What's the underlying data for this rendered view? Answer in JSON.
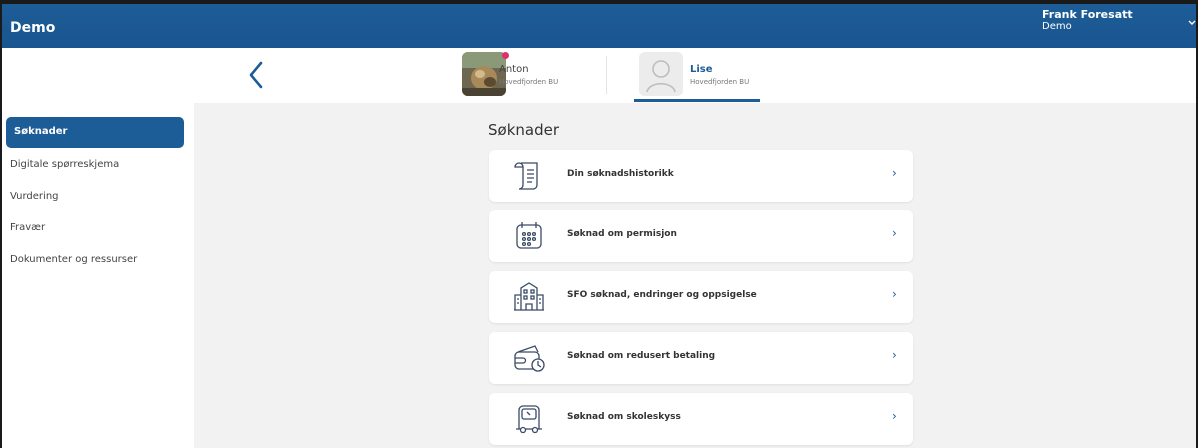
{
  "app": {
    "title": "Demo"
  },
  "user": {
    "name": "Frank Foresatt",
    "org": "Demo",
    "menu_icon": "chevron-down-icon"
  },
  "children": [
    {
      "name": "Anton",
      "school": "Hovedfjorden BU",
      "has_notification": true,
      "selected": false
    },
    {
      "name": "Lise",
      "school": "Hovedfjorden BU",
      "has_notification": false,
      "selected": true
    }
  ],
  "sidebar": {
    "items": [
      {
        "label": "Søknader",
        "active": true
      },
      {
        "label": "Digitale spørreskjema",
        "active": false
      },
      {
        "label": "Vurdering",
        "active": false
      },
      {
        "label": "Fravær",
        "active": false
      },
      {
        "label": "Dokumenter og ressurser",
        "active": false
      }
    ]
  },
  "main": {
    "title": "Søknader",
    "cards": [
      {
        "label": "Din søknadshistorikk",
        "icon": "scroll-icon",
        "chevron": "›"
      },
      {
        "label": "Søknad om permisjon",
        "icon": "calendar-icon",
        "chevron": "›"
      },
      {
        "label": "SFO søknad, endringer og oppsigelse",
        "icon": "school-building-icon",
        "chevron": "›"
      },
      {
        "label": "Søknad om redusert betaling",
        "icon": "wallet-coin-icon",
        "chevron": "›"
      },
      {
        "label": "Søknad om skoleskyss",
        "icon": "bus-icon",
        "chevron": "›"
      }
    ]
  },
  "colors": {
    "primary": "#1d5d97",
    "background": "#f2f2f2",
    "notification": "#e0306b"
  }
}
